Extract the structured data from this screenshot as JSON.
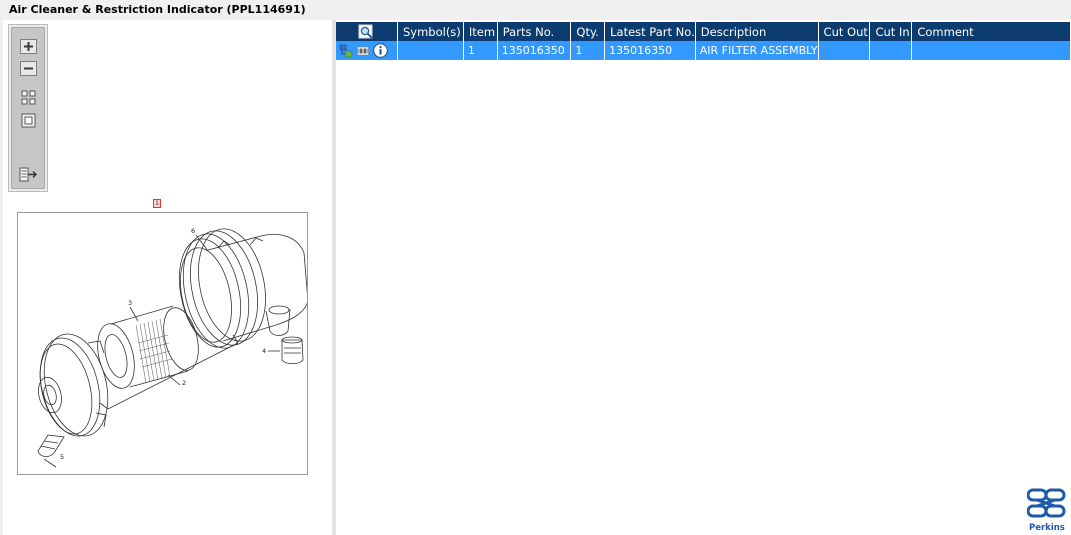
{
  "window": {
    "title": "Air Cleaner & Restriction Indicator (PPL114691)"
  },
  "toolbar": {
    "buttons": [
      {
        "name": "zoom-in",
        "icon": "zoom-in-icon"
      },
      {
        "name": "zoom-out",
        "icon": "zoom-out-icon"
      },
      {
        "name": "fit-all",
        "icon": "fit-all-icon"
      },
      {
        "name": "fit-window",
        "icon": "fit-window-icon"
      },
      {
        "name": "export",
        "icon": "export-icon"
      }
    ]
  },
  "illustration": {
    "callouts": [
      "1",
      "2",
      "3",
      "4",
      "5",
      "6"
    ],
    "highlight_callout": "1"
  },
  "table": {
    "columns": [
      {
        "key": "icons",
        "label": ""
      },
      {
        "key": "symbols",
        "label": "Symbol(s)"
      },
      {
        "key": "item",
        "label": "Item"
      },
      {
        "key": "parts_no",
        "label": "Parts No."
      },
      {
        "key": "qty",
        "label": "Qty."
      },
      {
        "key": "latest_part_no",
        "label": "Latest Part No."
      },
      {
        "key": "description",
        "label": "Description"
      },
      {
        "key": "cut_out",
        "label": "Cut Out"
      },
      {
        "key": "cut_in",
        "label": "Cut In"
      },
      {
        "key": "comment",
        "label": "Comment"
      }
    ],
    "header_icon": "magnify-search-icon",
    "rows": [
      {
        "icons": [
          "part-tree-icon",
          "barcode-icon",
          "info-icon"
        ],
        "symbols": "",
        "item": "1",
        "parts_no": "135016350",
        "qty": "1",
        "latest_part_no": "135016350",
        "description": "AIR FILTER ASSEMBLY",
        "cut_out": "",
        "cut_in": "",
        "comment": ""
      }
    ]
  },
  "brand": {
    "name": "Perkins",
    "color": "#1e5aa8"
  },
  "colors": {
    "header_bg": "#0c3b6f",
    "selected_row": "#3399ff"
  }
}
